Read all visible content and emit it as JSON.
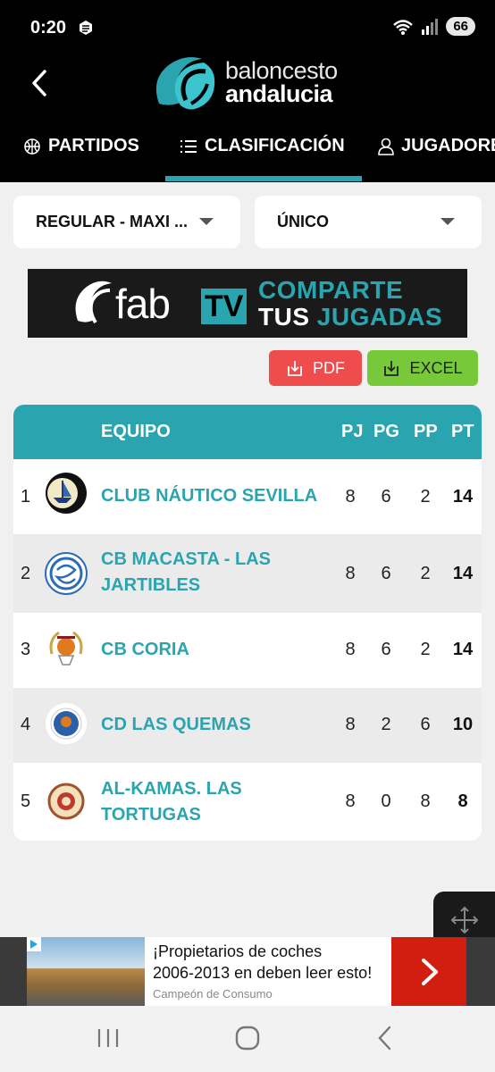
{
  "status": {
    "time": "0:20",
    "battery": "66",
    "network": "5"
  },
  "app": {
    "brand_top": "baloncesto",
    "brand_bottom": "andalucia"
  },
  "tabs": [
    {
      "label": "PARTIDOS",
      "icon": "basketball-icon"
    },
    {
      "label": "CLASIFICACIÓN",
      "icon": "list-icon",
      "active": true
    },
    {
      "label": "JUGADORES",
      "icon": "person-icon"
    }
  ],
  "filters": {
    "competition": "REGULAR - MAXI ...",
    "group": "ÚNICO"
  },
  "banner": {
    "brand": "fab",
    "tv": "TV",
    "line1": "COMPARTE",
    "line2a": "TUS",
    "line2b": "JUGADAS"
  },
  "export": {
    "pdf": "PDF",
    "excel": "EXCEL"
  },
  "table": {
    "headers": {
      "team": "EQUIPO",
      "pj": "PJ",
      "pg": "PG",
      "pp": "PP",
      "pt": "PT"
    },
    "rows": [
      {
        "pos": "1",
        "team": "CLUB NÁUTICO SEVILLA",
        "pj": "8",
        "pg": "6",
        "pp": "2",
        "pt": "14"
      },
      {
        "pos": "2",
        "team": "CB MACASTA - LAS JARTIBLES",
        "pj": "8",
        "pg": "6",
        "pp": "2",
        "pt": "14"
      },
      {
        "pos": "3",
        "team": "CB CORIA",
        "pj": "8",
        "pg": "6",
        "pp": "2",
        "pt": "14"
      },
      {
        "pos": "4",
        "team": "CD LAS QUEMAS",
        "pj": "8",
        "pg": "2",
        "pp": "6",
        "pt": "10"
      },
      {
        "pos": "5",
        "team": "AL-KAMAS. LAS TORTUGAS",
        "pj": "8",
        "pg": "0",
        "pp": "8",
        "pt": "8"
      }
    ]
  },
  "ad": {
    "line1": "¡Propietarios de coches",
    "line2": "2006-2013 en deben leer esto!",
    "source": "Campeón de Consumo"
  },
  "colors": {
    "accent": "#2aa5b0",
    "pdf": "#ef4d4d",
    "excel": "#77c93a",
    "ad_cta": "#d11e10"
  }
}
